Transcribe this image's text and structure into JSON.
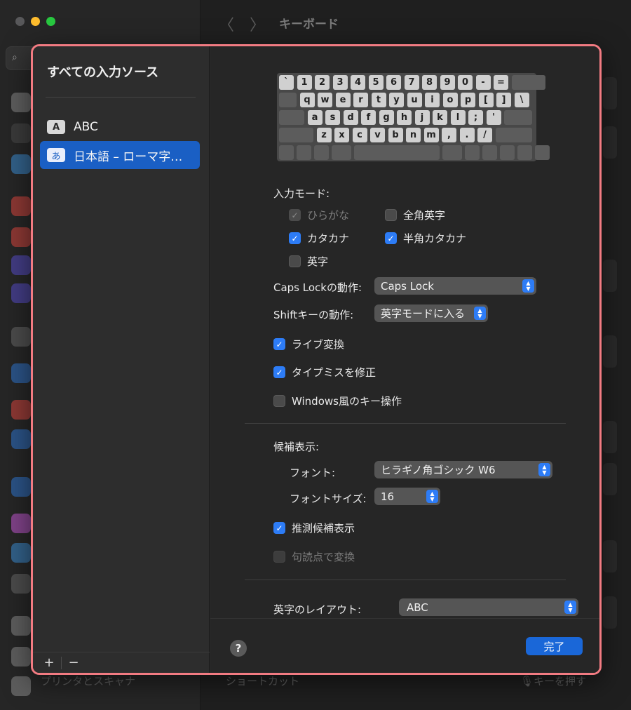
{
  "window": {
    "title": "キーボード",
    "bottom_row_label": "プリンタとスキャナ",
    "bottom_shortcut_label": "ショートカット",
    "bottom_shortcut_value": "🎙キーを押す"
  },
  "sheet": {
    "left_title": "すべての入力ソース",
    "sources": [
      {
        "badge": "A",
        "label": "ABC"
      },
      {
        "badge": "あ",
        "label": "日本語 – ローマ字…"
      }
    ],
    "add_label": "+",
    "remove_label": "−",
    "keyboard": {
      "row1": [
        "`",
        "1",
        "2",
        "3",
        "4",
        "5",
        "6",
        "7",
        "8",
        "9",
        "0",
        "-",
        "="
      ],
      "row2": [
        "q",
        "w",
        "e",
        "r",
        "t",
        "y",
        "u",
        "i",
        "o",
        "p",
        "[",
        "]",
        "\\"
      ],
      "row3": [
        "a",
        "s",
        "d",
        "f",
        "g",
        "h",
        "j",
        "k",
        "l",
        ";",
        "'"
      ],
      "row4": [
        "z",
        "x",
        "c",
        "v",
        "b",
        "n",
        "m",
        ",",
        ".",
        "/"
      ]
    },
    "input_mode_label": "入力モード:",
    "input_modes": {
      "hiragana": "ひらがな",
      "zenkaku_eiji": "全角英字",
      "katakana": "カタカナ",
      "hankaku_katakana": "半角カタカナ",
      "eiji": "英字"
    },
    "caps_lock_label": "Caps Lockの動作:",
    "caps_lock_value": "Caps Lock",
    "shift_label": "Shiftキーの動作:",
    "shift_value": "英字モードに入る",
    "live_conversion": "ライブ変換",
    "typo_correction": "タイプミスを修正",
    "windows_keys": "Windows風のキー操作",
    "candidates_label": "候補表示:",
    "font_label": "フォント:",
    "font_value": "ヒラギノ角ゴシック W6",
    "font_size_label": "フォントサイズ:",
    "font_size_value": "16",
    "predictive": "推測候補表示",
    "punctuation_convert": "句読点で変換",
    "layout_label": "英字のレイアウト:",
    "layout_value": "ABC",
    "help_label": "?",
    "done_label": "完了"
  },
  "colors": {
    "accent": "#2d7cf6",
    "selection": "#1a5fc4",
    "highlight_border": "#f27b82"
  }
}
